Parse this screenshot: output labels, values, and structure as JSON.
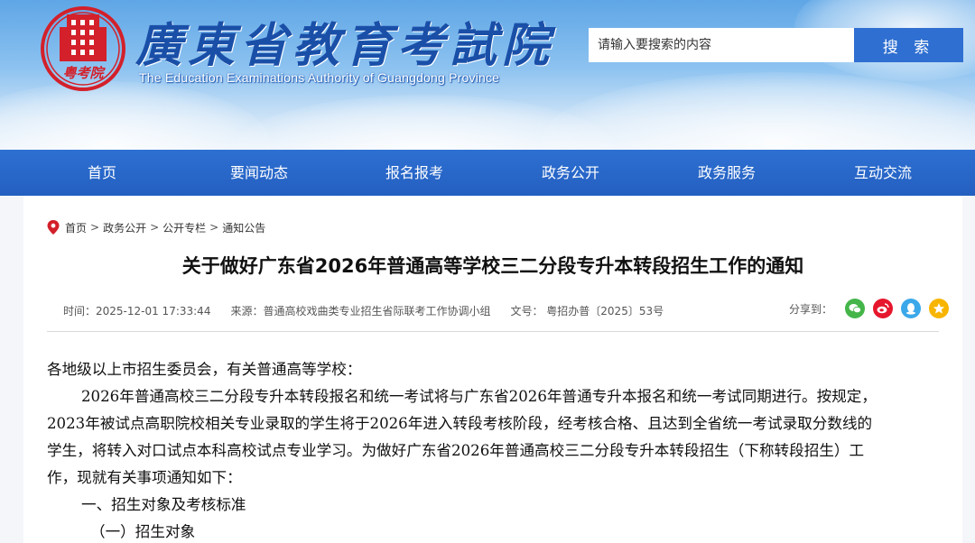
{
  "header": {
    "site_title": "廣東省教育考試院",
    "site_subtitle": "The Education Examinations Authority of Guangdong Province",
    "logo_text": "粤考院",
    "search_placeholder": "请输入要搜索的内容",
    "search_value": "",
    "search_button": "搜 索"
  },
  "nav": {
    "items": [
      {
        "label": "首页"
      },
      {
        "label": "要闻动态"
      },
      {
        "label": "报名报考"
      },
      {
        "label": "政务公开"
      },
      {
        "label": "政务服务"
      },
      {
        "label": "互动交流"
      }
    ]
  },
  "breadcrumb": {
    "separator": ">",
    "items": [
      "首页",
      "政务公开",
      "公开专栏",
      "通知公告"
    ]
  },
  "article": {
    "title": "关于做好广东省2026年普通高等学校三二分段专升本转段招生工作的通知",
    "time": "时间：2025-12-01 17:33:44",
    "source": "来源：普通高校戏曲类专业招生省际联考工作协调小组",
    "doc_no": "文号： 粤招办普〔2025〕53号",
    "share_label": "分享到：",
    "paragraphs": {
      "p0": "各地级以上市招生委员会，有关普通高等学校：",
      "p1a": "2026年普通高校三二分段专升本转段报名和统一考试将与广东省2026年普通专升本报名和统一考试同期进行。按规定，",
      "p1b": "2023年被试点高职院校相关专业录取的学生将于2026年进入转段考核阶段，经考核合格、且达到全省统一考试录取分数线的",
      "p1c": "学生，将转入对口试点本科高校试点专业学习。为做好广东省2026年普通高校三二分段专升本转段招生（下称转段招生）工",
      "p1d": "作，现就有关事项通知如下：",
      "h1": "一、招生对象及考核标准",
      "h2": "（一）招生对象"
    }
  },
  "colors": {
    "nav_bg": "#2d70d2",
    "search_button_bg": "#2f6fd1",
    "title_color": "#1a4fa8",
    "wechat": "#44b549",
    "weibo": "#e6162d",
    "qq": "#3ba8ea",
    "qzone": "#f7b500"
  },
  "icons": [
    "location-pin-icon",
    "wechat-icon",
    "weibo-icon",
    "qq-icon",
    "qzone-icon"
  ]
}
